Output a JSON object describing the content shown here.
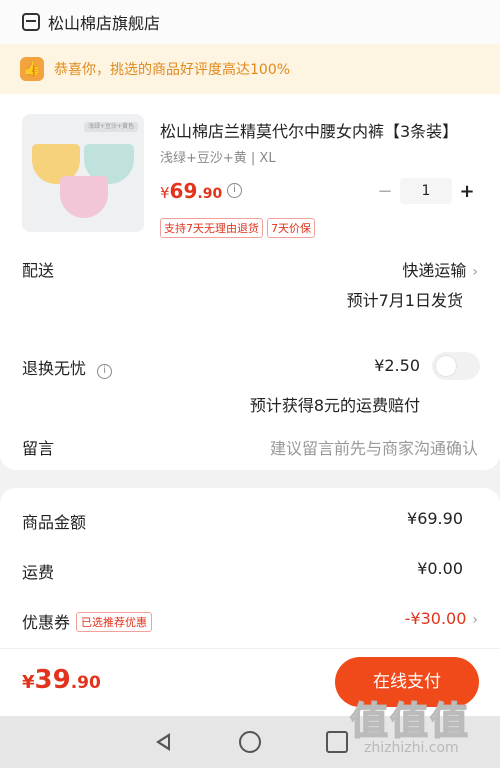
{
  "header": {
    "shop_name": "松山棉店旗舰店",
    "icon": "store-icon"
  },
  "tip": {
    "icon": "thumbs-up-icon",
    "glyph": "👍",
    "text": "恭喜你，挑选的商品好评度高达100%"
  },
  "product": {
    "image_strip_text": "浅绿+豆沙+黄色",
    "title": "松山棉店兰精莫代尔中腰女内裤【3条装】",
    "sku": "浅绿+豆沙+黄 | XL",
    "price": {
      "currency": "¥",
      "integer": "69",
      "decimal": ".90"
    },
    "info_glyph": "i",
    "quantity": {
      "minus": "−",
      "value": "1",
      "plus": "+"
    },
    "badges": [
      "支持7天无理由退货",
      "7天价保"
    ]
  },
  "delivery": {
    "label": "配送",
    "method": "快递运输",
    "chevron": "›",
    "estimate": "预计7月1日发货"
  },
  "return_insurance": {
    "label": "退换无忧",
    "info_glyph": "i",
    "price": "¥2.50",
    "enabled": false,
    "note": "预计获得8元的运费赔付"
  },
  "message": {
    "label": "留言",
    "placeholder": "建议留言前先与商家沟通确认"
  },
  "summary": {
    "goods_amount": {
      "label": "商品金额",
      "value": "¥69.90"
    },
    "shipping": {
      "label": "运费",
      "value": "¥0.00"
    },
    "coupon": {
      "label": "优惠券",
      "tag": "已选推荐优惠",
      "value": "-¥30.00",
      "chevron": "›"
    }
  },
  "pay": {
    "currency": "¥",
    "integer": "39",
    "decimal": ".90",
    "button_label": "在线支付"
  },
  "watermark": {
    "big": "值值值",
    "small": "zhizhizhi.com"
  },
  "colors": {
    "accent": "#e2341d",
    "button": "#f04a1b",
    "tip_bg": "#fdf4e1",
    "tip_text": "#e08a1e"
  }
}
